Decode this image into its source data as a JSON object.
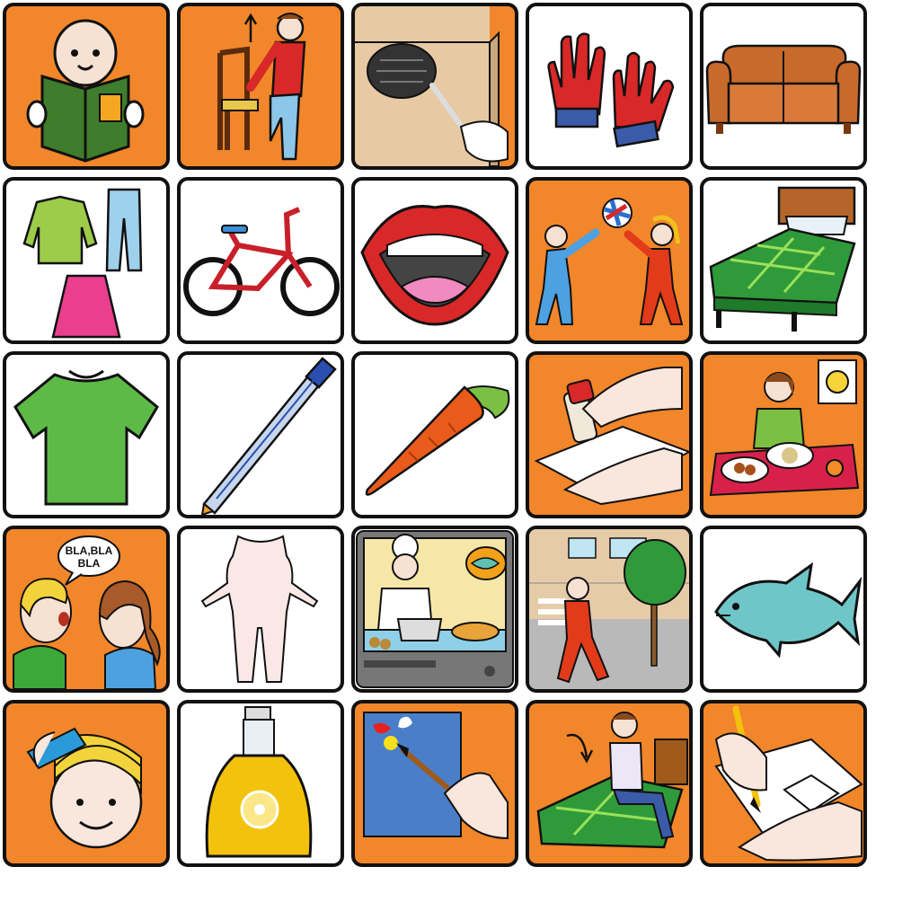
{
  "board": {
    "speech_bubble_text": [
      "BLA,BLA",
      "BLA"
    ],
    "colors": {
      "fitzgerald_orange": "#f2862a",
      "white": "#ffffff",
      "border": "#111111"
    },
    "cells": [
      {
        "row": 1,
        "col": 1,
        "picture": "person-reading-book-icon",
        "bg": "orange"
      },
      {
        "row": 1,
        "col": 2,
        "picture": "person-standing-up-from-chair-icon",
        "bg": "orange"
      },
      {
        "row": 1,
        "col": 3,
        "picture": "feather-duster-cleaning-table-icon",
        "bg": "orange"
      },
      {
        "row": 1,
        "col": 4,
        "picture": "red-gloves-icon",
        "bg": "white"
      },
      {
        "row": 1,
        "col": 5,
        "picture": "sofa-icon",
        "bg": "white"
      },
      {
        "row": 2,
        "col": 1,
        "picture": "clothes-sweater-jeans-skirt-icon",
        "bg": "white"
      },
      {
        "row": 2,
        "col": 2,
        "picture": "bicycle-icon",
        "bg": "white"
      },
      {
        "row": 2,
        "col": 3,
        "picture": "open-mouth-icon",
        "bg": "white"
      },
      {
        "row": 2,
        "col": 4,
        "picture": "children-playing-ball-icon",
        "bg": "orange"
      },
      {
        "row": 2,
        "col": 5,
        "picture": "bed-icon",
        "bg": "white"
      },
      {
        "row": 3,
        "col": 1,
        "picture": "green-t-shirt-icon",
        "bg": "white"
      },
      {
        "row": 3,
        "col": 2,
        "picture": "ballpoint-pen-icon",
        "bg": "white"
      },
      {
        "row": 3,
        "col": 3,
        "picture": "carrot-icon",
        "bg": "white"
      },
      {
        "row": 3,
        "col": 4,
        "picture": "gluing-paper-icon",
        "bg": "orange"
      },
      {
        "row": 3,
        "col": 5,
        "picture": "person-eating-at-table-icon",
        "bg": "orange"
      },
      {
        "row": 4,
        "col": 1,
        "picture": "two-people-talking-icon",
        "bg": "orange"
      },
      {
        "row": 4,
        "col": 2,
        "picture": "human-body-icon",
        "bg": "white"
      },
      {
        "row": 4,
        "col": 3,
        "picture": "cooking-show-tv-icon",
        "bg": "white"
      },
      {
        "row": 4,
        "col": 4,
        "picture": "person-walking-street-icon",
        "bg": "white"
      },
      {
        "row": 4,
        "col": 5,
        "picture": "fish-icon",
        "bg": "white"
      },
      {
        "row": 5,
        "col": 1,
        "picture": "combing-hair-icon",
        "bg": "orange"
      },
      {
        "row": 5,
        "col": 2,
        "picture": "perfume-bottle-icon",
        "bg": "white"
      },
      {
        "row": 5,
        "col": 3,
        "picture": "painting-with-brush-icon",
        "bg": "orange"
      },
      {
        "row": 5,
        "col": 4,
        "picture": "person-sitting-on-bed-icon",
        "bg": "orange"
      },
      {
        "row": 5,
        "col": 5,
        "picture": "drawing-with-pencil-icon",
        "bg": "orange"
      }
    ]
  }
}
